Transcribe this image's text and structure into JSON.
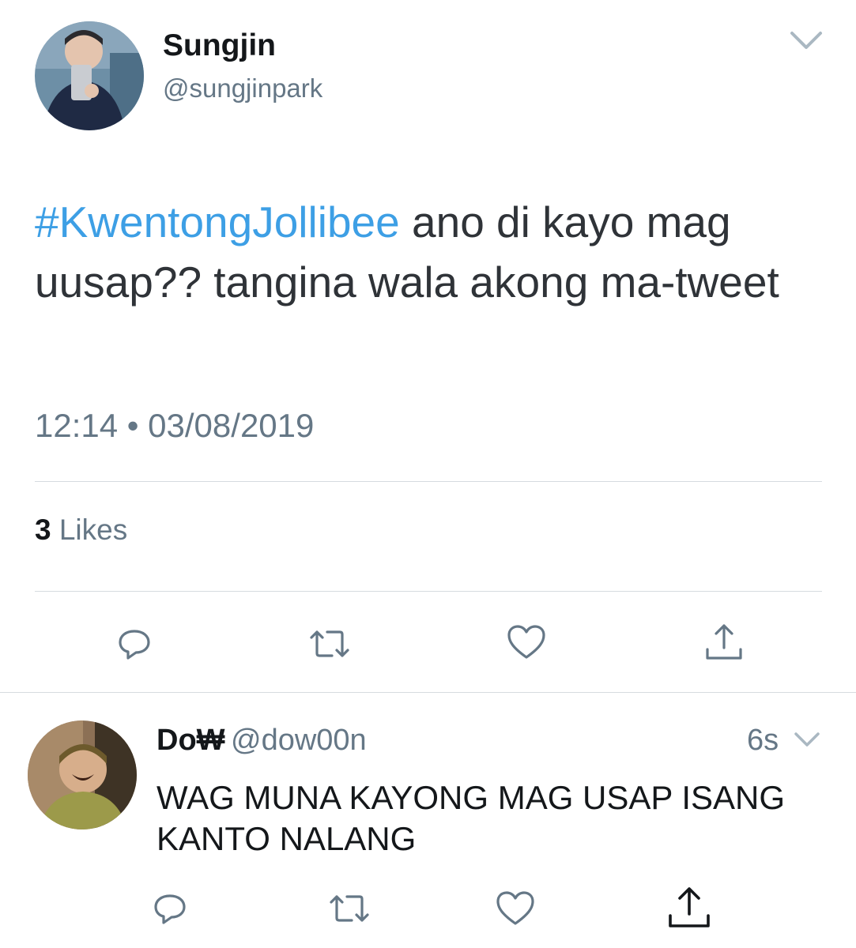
{
  "tweet": {
    "author": {
      "name": "Sungjin",
      "handle": "@sungjinpark"
    },
    "hashtag": "#KwentongJollibee",
    "text": " ano di kayo mag uusap?? tangina wala akong ma-tweet",
    "time": "12:14",
    "separator": "•",
    "date": "03/08/2019",
    "likes_count": "3",
    "likes_label": " Likes",
    "actions": [
      "reply-icon",
      "retweet-icon",
      "like-icon",
      "share-icon"
    ]
  },
  "reply": {
    "author": {
      "name": "Do₩",
      "handle": "@dow00n"
    },
    "time": "6s",
    "text": "WAG MUNA KAYONG MAG USAP ISANG KANTO NALANG",
    "actions": [
      "reply-icon",
      "retweet-icon",
      "like-icon",
      "share-icon"
    ]
  },
  "colors": {
    "hashtag": "#3d9fe5",
    "secondary_text": "#657786",
    "icon": "#657786",
    "divider": "#d6dbdf"
  }
}
